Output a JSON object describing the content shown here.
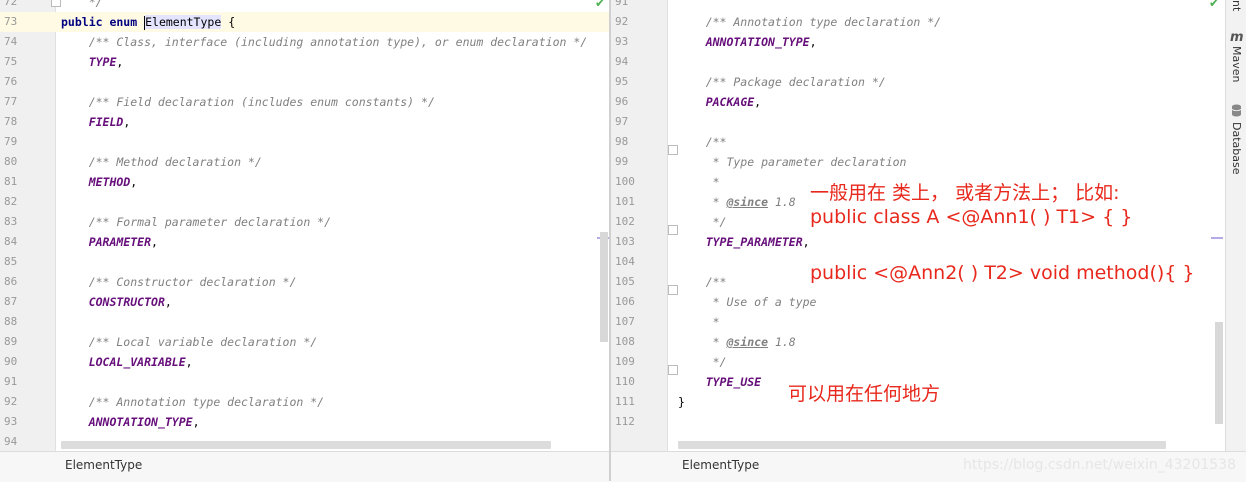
{
  "left_editor": {
    "lines": [
      {
        "n": "72",
        "parts": [
          {
            "t": "    */",
            "c": "cm"
          }
        ]
      },
      {
        "n": "73",
        "current": true,
        "parts": [
          {
            "t": "public enum ",
            "c": "kw"
          },
          {
            "t": "caret"
          },
          {
            "t": "ElementType",
            "c": "ident-hl"
          },
          {
            "t": " {",
            "c": ""
          }
        ]
      },
      {
        "n": "74",
        "parts": [
          {
            "t": "    /** Class, interface (including annotation type), or enum declaration */",
            "c": "cm"
          }
        ]
      },
      {
        "n": "75",
        "parts": [
          {
            "t": "    ",
            "c": ""
          },
          {
            "t": "TYPE",
            "c": "cst"
          },
          {
            "t": ",",
            "c": ""
          }
        ]
      },
      {
        "n": "76",
        "parts": []
      },
      {
        "n": "77",
        "parts": [
          {
            "t": "    /** Field declaration (includes enum constants) */",
            "c": "cm"
          }
        ]
      },
      {
        "n": "78",
        "parts": [
          {
            "t": "    ",
            "c": ""
          },
          {
            "t": "FIELD",
            "c": "cst"
          },
          {
            "t": ",",
            "c": ""
          }
        ]
      },
      {
        "n": "79",
        "parts": []
      },
      {
        "n": "80",
        "parts": [
          {
            "t": "    /** Method declaration */",
            "c": "cm"
          }
        ]
      },
      {
        "n": "81",
        "parts": [
          {
            "t": "    ",
            "c": ""
          },
          {
            "t": "METHOD",
            "c": "cst"
          },
          {
            "t": ",",
            "c": ""
          }
        ]
      },
      {
        "n": "82",
        "parts": []
      },
      {
        "n": "83",
        "parts": [
          {
            "t": "    /** Formal parameter declaration */",
            "c": "cm"
          }
        ]
      },
      {
        "n": "84",
        "parts": [
          {
            "t": "    ",
            "c": ""
          },
          {
            "t": "PARAMETER",
            "c": "cst"
          },
          {
            "t": ",",
            "c": ""
          }
        ]
      },
      {
        "n": "85",
        "parts": []
      },
      {
        "n": "86",
        "parts": [
          {
            "t": "    /** Constructor declaration */",
            "c": "cm"
          }
        ]
      },
      {
        "n": "87",
        "parts": [
          {
            "t": "    ",
            "c": ""
          },
          {
            "t": "CONSTRUCTOR",
            "c": "cst"
          },
          {
            "t": ",",
            "c": ""
          }
        ]
      },
      {
        "n": "88",
        "parts": []
      },
      {
        "n": "89",
        "parts": [
          {
            "t": "    /** Local variable declaration */",
            "c": "cm"
          }
        ]
      },
      {
        "n": "90",
        "parts": [
          {
            "t": "    ",
            "c": ""
          },
          {
            "t": "LOCAL_VARIABLE",
            "c": "cst"
          },
          {
            "t": ",",
            "c": ""
          }
        ]
      },
      {
        "n": "91",
        "parts": []
      },
      {
        "n": "92",
        "parts": [
          {
            "t": "    /** Annotation type declaration */",
            "c": "cm"
          }
        ]
      },
      {
        "n": "93",
        "parts": [
          {
            "t": "    ",
            "c": ""
          },
          {
            "t": "ANNOTATION_TYPE",
            "c": "cst"
          },
          {
            "t": ",",
            "c": ""
          }
        ]
      },
      {
        "n": "94",
        "parts": []
      }
    ]
  },
  "right_editor": {
    "lines": [
      {
        "n": "91",
        "parts": []
      },
      {
        "n": "92",
        "parts": [
          {
            "t": "    /** Annotation type declaration */",
            "c": "cm"
          }
        ]
      },
      {
        "n": "93",
        "parts": [
          {
            "t": "    ",
            "c": ""
          },
          {
            "t": "ANNOTATION_TYPE",
            "c": "cst"
          },
          {
            "t": ",",
            "c": ""
          }
        ]
      },
      {
        "n": "94",
        "parts": []
      },
      {
        "n": "95",
        "parts": [
          {
            "t": "    /** Package declaration */",
            "c": "cm"
          }
        ]
      },
      {
        "n": "96",
        "parts": [
          {
            "t": "    ",
            "c": ""
          },
          {
            "t": "PACKAGE",
            "c": "cst"
          },
          {
            "t": ",",
            "c": ""
          }
        ]
      },
      {
        "n": "97",
        "parts": []
      },
      {
        "n": "98",
        "parts": [
          {
            "t": "    /**",
            "c": "cm"
          }
        ]
      },
      {
        "n": "99",
        "parts": [
          {
            "t": "     * Type parameter declaration",
            "c": "cm"
          }
        ]
      },
      {
        "n": "100",
        "parts": [
          {
            "t": "     *",
            "c": "cm"
          }
        ]
      },
      {
        "n": "101",
        "parts": [
          {
            "t": "     * ",
            "c": "cm"
          },
          {
            "t": "@since",
            "c": "tag"
          },
          {
            "t": " 1.8",
            "c": "cm"
          }
        ]
      },
      {
        "n": "102",
        "parts": [
          {
            "t": "     */",
            "c": "cm"
          }
        ]
      },
      {
        "n": "103",
        "parts": [
          {
            "t": "    ",
            "c": ""
          },
          {
            "t": "TYPE_PARAMETER",
            "c": "cst"
          },
          {
            "t": ",",
            "c": ""
          }
        ]
      },
      {
        "n": "104",
        "parts": []
      },
      {
        "n": "105",
        "parts": [
          {
            "t": "    /**",
            "c": "cm"
          }
        ]
      },
      {
        "n": "106",
        "parts": [
          {
            "t": "     * Use of a type",
            "c": "cm"
          }
        ]
      },
      {
        "n": "107",
        "parts": [
          {
            "t": "     *",
            "c": "cm"
          }
        ]
      },
      {
        "n": "108",
        "parts": [
          {
            "t": "     * ",
            "c": "cm"
          },
          {
            "t": "@since",
            "c": "tag"
          },
          {
            "t": " 1.8",
            "c": "cm"
          }
        ]
      },
      {
        "n": "109",
        "parts": [
          {
            "t": "     */",
            "c": "cm"
          }
        ]
      },
      {
        "n": "110",
        "parts": [
          {
            "t": "    ",
            "c": ""
          },
          {
            "t": "TYPE_USE",
            "c": "cst"
          }
        ]
      },
      {
        "n": "111",
        "parts": [
          {
            "t": "}",
            "c": ""
          }
        ]
      },
      {
        "n": "112",
        "parts": []
      }
    ]
  },
  "status": {
    "left_breadcrumb": "ElementType",
    "right_breadcrumb": "ElementType",
    "watermark": "https://blog.csdn.net/weixin_43201538"
  },
  "tool_window": {
    "partial_label": "nt",
    "maven_label": "Maven",
    "database_label": "Database"
  },
  "annotations": {
    "line1": "一般用在 类上， 或者方法上；   比如:",
    "line2": "public class A <@Ann1( ) T1> {  }",
    "line3": "public <@Ann2( ) T2> void method(){ }",
    "line4": "可以用在任何地方"
  },
  "colors": {
    "keyword": "#000080",
    "constant": "#660e7a",
    "comment": "#808080",
    "annotation_text": "#e8281c",
    "current_line": "#fffae3"
  }
}
